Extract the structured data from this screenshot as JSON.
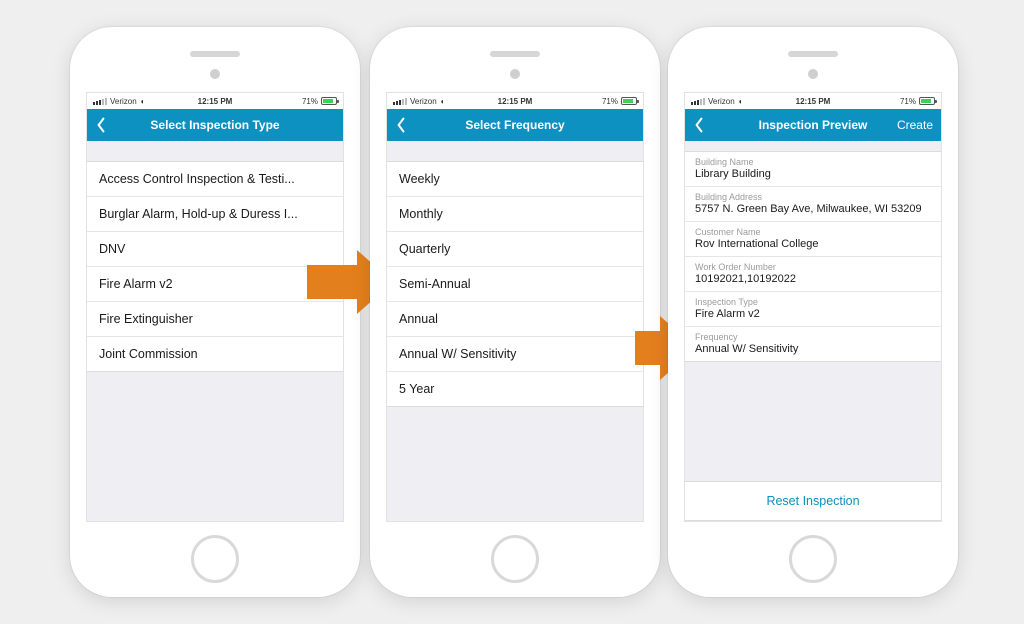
{
  "status": {
    "carrier": "Verizon",
    "time": "12:15 PM",
    "battery_pct": "71%"
  },
  "phone1": {
    "title": "Select Inspection Type",
    "items": [
      "Access Control Inspection & Testi...",
      "Burglar Alarm, Hold-up & Duress I...",
      "DNV",
      "Fire Alarm v2",
      "Fire Extinguisher",
      "Joint Commission"
    ]
  },
  "phone2": {
    "title": "Select Frequency",
    "items": [
      "Weekly",
      "Monthly",
      "Quarterly",
      "Semi-Annual",
      "Annual",
      "Annual W/ Sensitivity",
      "5 Year"
    ]
  },
  "phone3": {
    "title": "Inspection Preview",
    "action": "Create",
    "fields": [
      {
        "label": "Building Name",
        "value": "Library Building"
      },
      {
        "label": "Building Address",
        "value": "5757 N. Green Bay Ave, Milwaukee, WI 53209"
      },
      {
        "label": "Customer Name",
        "value": "Rov International College"
      },
      {
        "label": "Work Order Number",
        "value": "10192021,10192022"
      },
      {
        "label": "Inspection Type",
        "value": "Fire Alarm v2"
      },
      {
        "label": "Frequency",
        "value": "Annual W/ Sensitivity"
      }
    ],
    "reset": "Reset Inspection"
  }
}
